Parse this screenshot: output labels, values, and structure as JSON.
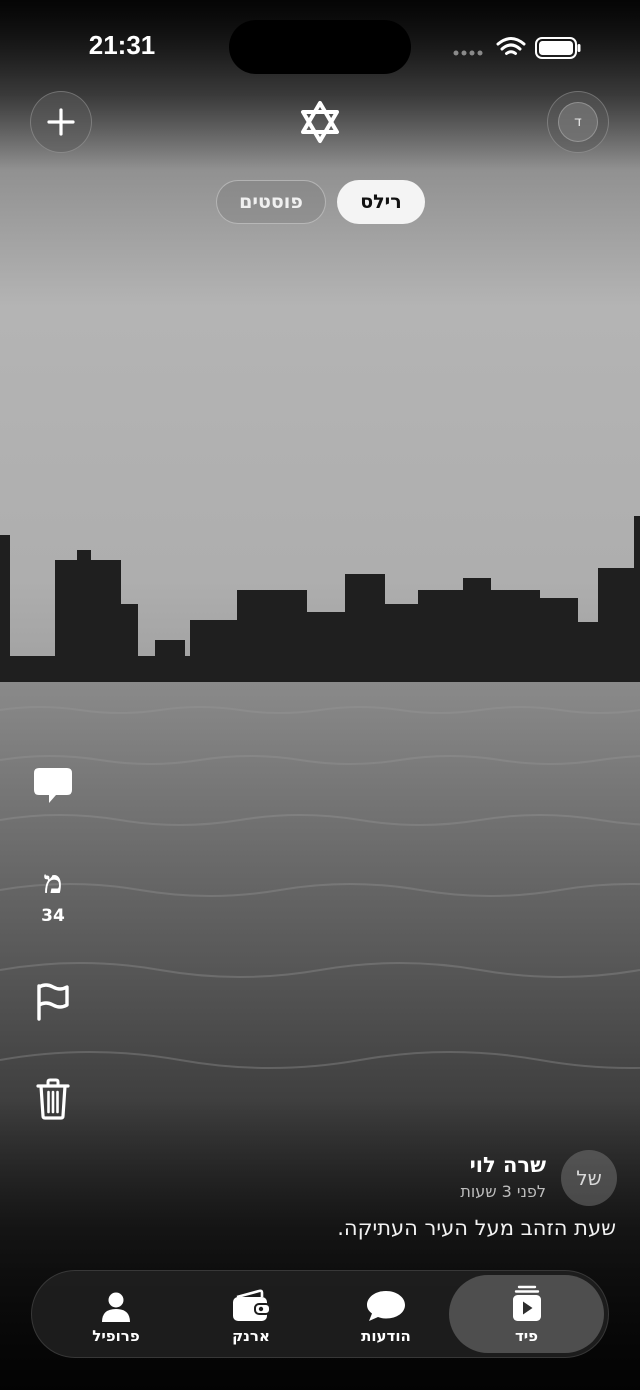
{
  "status_bar": {
    "time": "21:31"
  },
  "header": {
    "add_button_symbol": "+",
    "logo_icon": "star-of-david-icon",
    "avatar_initial": "ד"
  },
  "feed_tabs": [
    {
      "label": "רילס",
      "active": true
    },
    {
      "label": "פוסטים",
      "active": false
    }
  ],
  "side_actions": {
    "comment_icon": "speech-bubble-icon",
    "mem_letter": "מ",
    "mem_count": "34",
    "report_icon": "flag-icon",
    "delete_icon": "trash-icon"
  },
  "post": {
    "author_initials": "של",
    "author_name": "שרה לוי",
    "timestamp": "לפני 3 שעות",
    "caption": "שעת הזהב מעל העיר העתיקה."
  },
  "bottom_nav": {
    "items": [
      {
        "label": "פרופיל",
        "icon": "person-icon",
        "active": false
      },
      {
        "label": "ארנק",
        "icon": "wallet-icon",
        "active": false
      },
      {
        "label": "הודעות",
        "icon": "chat-bubble-icon",
        "active": false
      },
      {
        "label": "פיד",
        "icon": "play-stack-icon",
        "active": true
      }
    ]
  }
}
